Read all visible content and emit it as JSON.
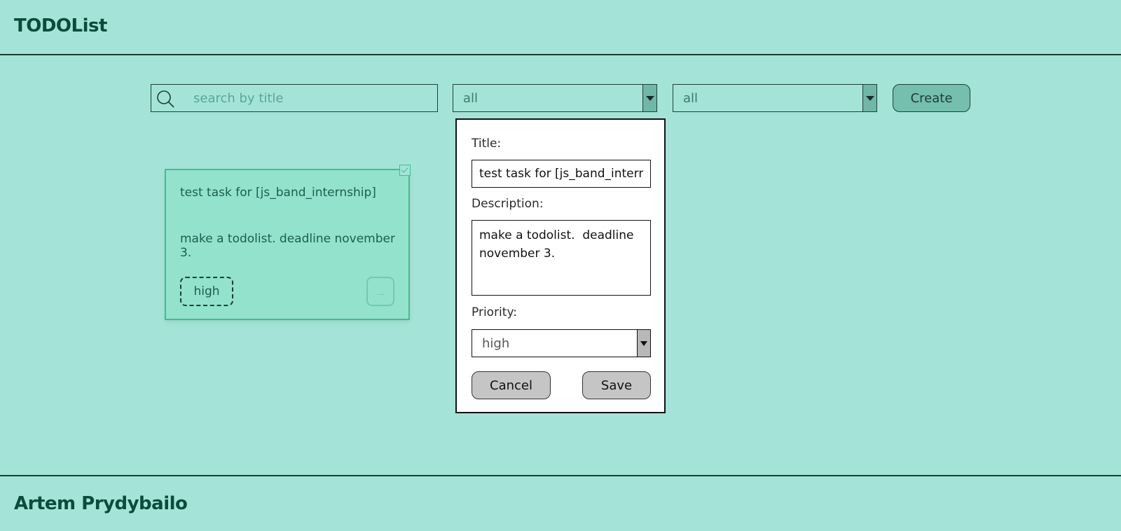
{
  "header": {
    "brand": "TODOList"
  },
  "toolbar": {
    "search_placeholder": "search by title",
    "status_filter": "all",
    "priority_filter": "all",
    "create_label": "Create"
  },
  "tasks": [
    {
      "title": "test task for [js_band_internship]",
      "description": "make a todolist. deadline november 3.",
      "priority": "high",
      "done": false,
      "more_label": "..."
    }
  ],
  "edit_modal": {
    "title_label": "Title:",
    "title_value": "test task for [js_band_internship]",
    "description_label": "Description:",
    "description_value": "make a todolist.  deadline november 3.",
    "priority_label": "Priority:",
    "priority_value": "high",
    "cancel_label": "Cancel",
    "save_label": "Save"
  },
  "footer": {
    "author": "Artem Prydybailo"
  }
}
